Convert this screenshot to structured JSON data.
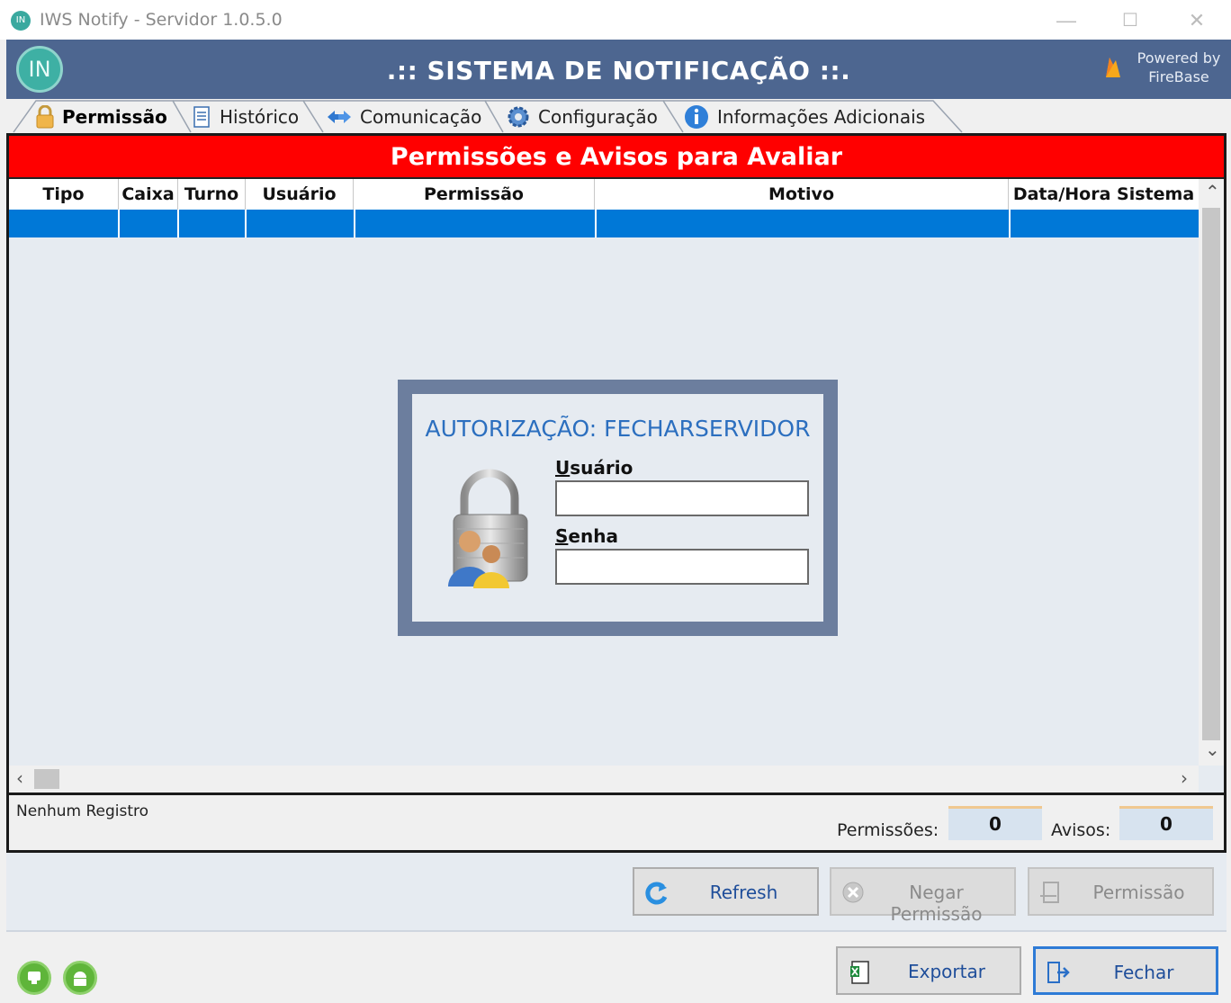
{
  "window": {
    "title": "IWS Notify - Servidor 1.0.5.0",
    "app_icon_text": "IN",
    "minimize": "—",
    "maximize": "☐",
    "close": "✕"
  },
  "header": {
    "logo_text": "IN",
    "title": ".:: SISTEMA DE NOTIFICAÇÃO ::.",
    "powered_by_line1": "Powered by",
    "powered_by_line2": "FireBase",
    "color": "#4d6690"
  },
  "tabs": [
    {
      "label": "Permissão",
      "icon": "lock-icon",
      "active": true
    },
    {
      "label": "Histórico",
      "icon": "document-icon",
      "active": false
    },
    {
      "label": "Comunicação",
      "icon": "exchange-arrows-icon",
      "active": false
    },
    {
      "label": "Configuração",
      "icon": "gear-icon",
      "active": false
    },
    {
      "label": "Informações Adicionais",
      "icon": "info-icon",
      "active": false
    }
  ],
  "panel": {
    "banner": "Permissões e Avisos para Avaliar",
    "banner_color": "#ff0000",
    "columns": [
      "Tipo",
      "Caixa",
      "Turno",
      "Usuário",
      "Permissão",
      "Motivo",
      "Data/Hora Sistema"
    ],
    "selected_row_color": "#0078d7",
    "status_text": "Nenhum Registro",
    "permissions_label": "Permissões:",
    "permissions_count": "0",
    "warnings_label": "Avisos:",
    "warnings_count": "0"
  },
  "auth_dialog": {
    "title": "AUTORIZAÇÃO: FECHARSERVIDOR",
    "user_label_accel": "U",
    "user_label_rest": "suário",
    "password_label_accel": "S",
    "password_label_rest": "enha",
    "user_value": "",
    "password_value": ""
  },
  "actions": {
    "refresh": "Refresh",
    "deny": "Negar Permissão",
    "permit": "Permissão",
    "export": "Exportar",
    "close": "Fechar"
  }
}
